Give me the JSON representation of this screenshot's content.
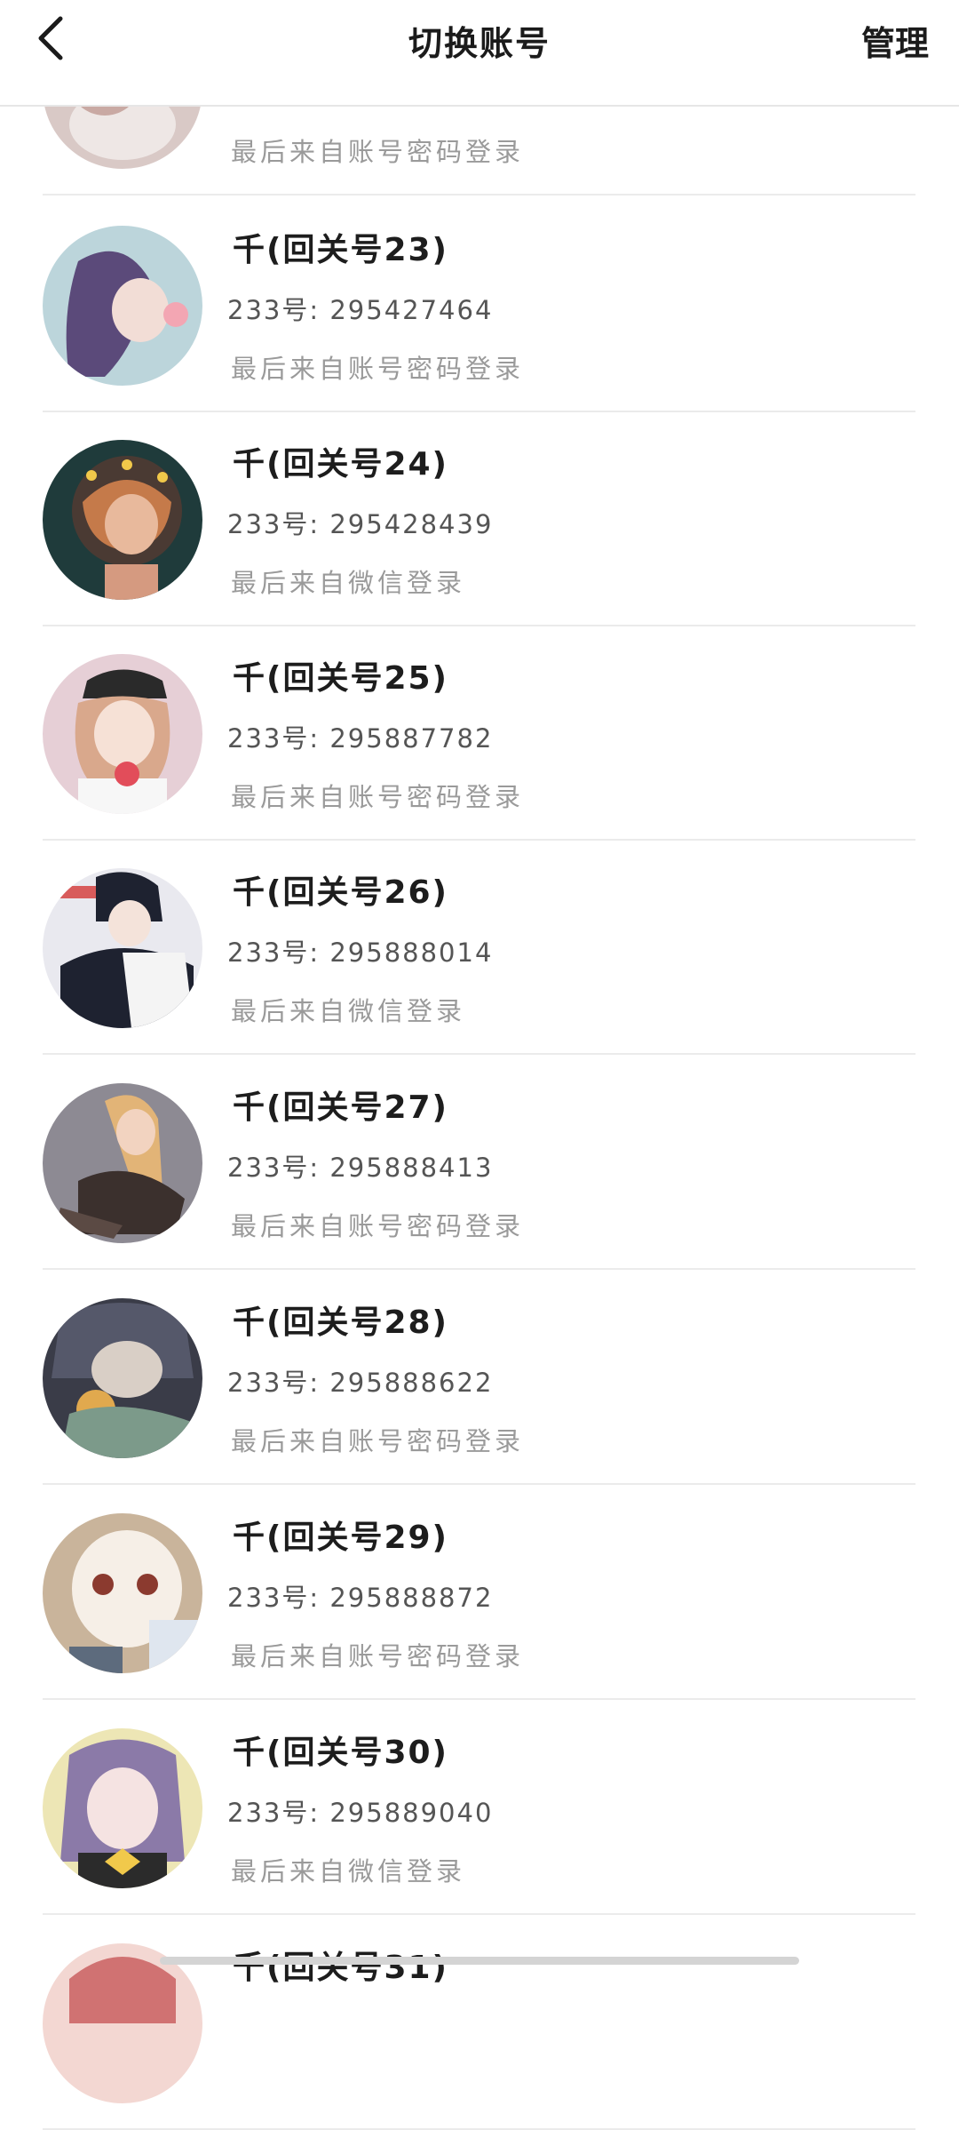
{
  "header": {
    "title": "切换账号",
    "manage_label": "管理",
    "back_icon": "chevron-left-icon"
  },
  "accounts": [
    {
      "name": "",
      "uid": "",
      "login_method": "最后来自账号密码登录",
      "avatar_colors": [
        "#d9c9c6",
        "#9c7f86"
      ]
    },
    {
      "name": "千(回关号23)",
      "uid": "233号: 295427464",
      "login_method": "最后来自账号密码登录",
      "avatar_colors": [
        "#bcd5db",
        "#5b4a7a"
      ]
    },
    {
      "name": "千(回关号24)",
      "uid": "233号: 295428439",
      "login_method": "最后来自微信登录",
      "avatar_colors": [
        "#1f3b3b",
        "#c57a4a"
      ]
    },
    {
      "name": "千(回关号25)",
      "uid": "233号: 295887782",
      "login_method": "最后来自账号密码登录",
      "avatar_colors": [
        "#e6cfd6",
        "#2a2a2a"
      ]
    },
    {
      "name": "千(回关号26)",
      "uid": "233号: 295888014",
      "login_method": "最后来自微信登录",
      "avatar_colors": [
        "#e9e9ef",
        "#1e2230"
      ]
    },
    {
      "name": "千(回关号27)",
      "uid": "233号: 295888413",
      "login_method": "最后来自账号密码登录",
      "avatar_colors": [
        "#8d8a93",
        "#e2b477"
      ]
    },
    {
      "name": "千(回关号28)",
      "uid": "233号: 295888622",
      "login_method": "最后来自账号密码登录",
      "avatar_colors": [
        "#3a3c48",
        "#7c9a8a"
      ]
    },
    {
      "name": "千(回关号29)",
      "uid": "233号: 295888872",
      "login_method": "最后来自账号密码登录",
      "avatar_colors": [
        "#c9b49b",
        "#f6efe7"
      ]
    },
    {
      "name": "千(回关号30)",
      "uid": "233号: 295889040",
      "login_method": "最后来自微信登录",
      "avatar_colors": [
        "#ede6b5",
        "#8b7aa8"
      ]
    },
    {
      "name": "千(回关号31)",
      "uid": "",
      "login_method": "",
      "avatar_colors": [
        "#d07272",
        "#f3d7d2"
      ]
    }
  ]
}
